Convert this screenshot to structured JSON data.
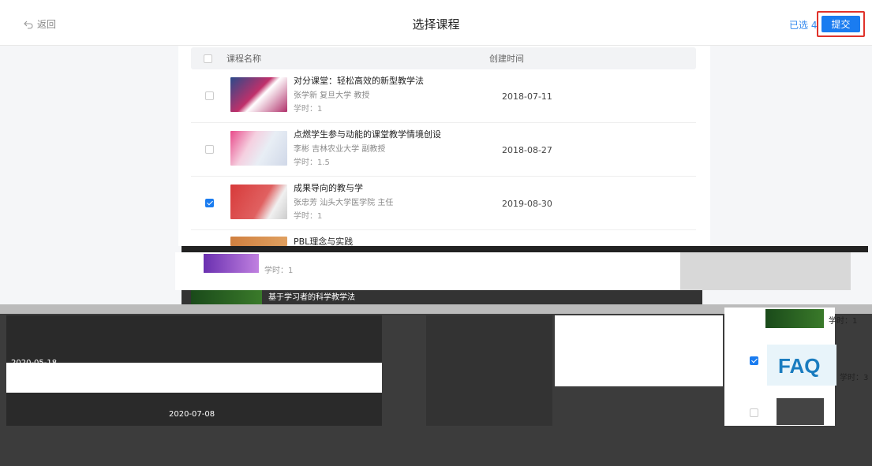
{
  "header": {
    "back_label": "返回",
    "title": "选择课程",
    "selected_label": "已选 4",
    "submit_label": "提交"
  },
  "table": {
    "col_name": "课程名称",
    "col_date": "创建时间"
  },
  "courses": [
    {
      "name": "对分课堂：轻松高效的新型教学法",
      "teacher": "张学新 复旦大学 教授",
      "hours": "学时：1",
      "date": "2018-07-11",
      "checked": false
    },
    {
      "name": "点燃学生参与动能的课堂教学情境创设",
      "teacher": "李彬 吉林农业大学 副教授",
      "hours": "学时：1.5",
      "date": "2018-08-27",
      "checked": false
    },
    {
      "name": "成果导向的教与学",
      "teacher": "张忠芳 汕头大学医学院 主任",
      "hours": "学时：1",
      "date": "2019-08-30",
      "checked": true
    },
    {
      "name": "PBL理念与实践",
      "hours": "学时：1",
      "checked": true
    }
  ],
  "glitch": {
    "row6_name": "基于学习者的科学教学法",
    "hours_right": "学时：1",
    "hours_right2": "学时：3",
    "faq_text": "FAQ",
    "date_left": "2020-05-18",
    "date_left2": "2020-07-08"
  },
  "colors": {
    "accent": "#1a7cf0",
    "highlight_border": "#e0322a"
  }
}
